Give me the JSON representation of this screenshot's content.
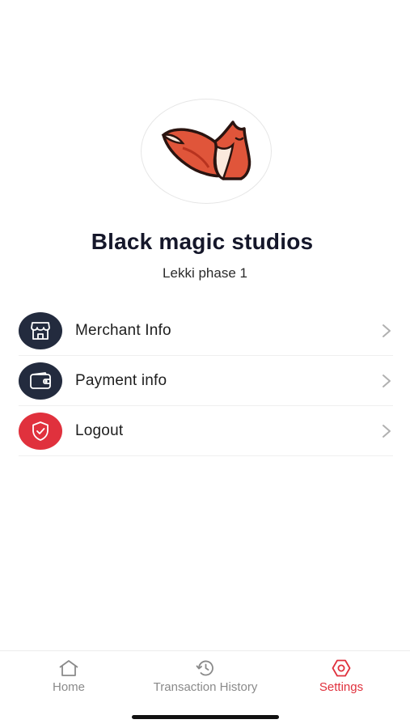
{
  "profile": {
    "name": "Black magic studios",
    "location": "Lekki phase 1",
    "logo_icon": "fox-logo-icon"
  },
  "menu": [
    {
      "label": "Merchant Info",
      "icon": "store-icon",
      "color": "#232b3e"
    },
    {
      "label": "Payment info",
      "icon": "wallet-icon",
      "color": "#232b3e"
    },
    {
      "label": "Logout",
      "icon": "shield-check-icon",
      "color": "#e0313d"
    }
  ],
  "tabs": [
    {
      "label": "Home",
      "icon": "home-icon",
      "active": false
    },
    {
      "label": "Transaction History",
      "icon": "history-icon",
      "active": false
    },
    {
      "label": "Settings",
      "icon": "settings-icon",
      "active": true
    }
  ],
  "colors": {
    "accent": "#e0313d",
    "dark": "#232b3e",
    "inactive": "#8a8a8a"
  }
}
